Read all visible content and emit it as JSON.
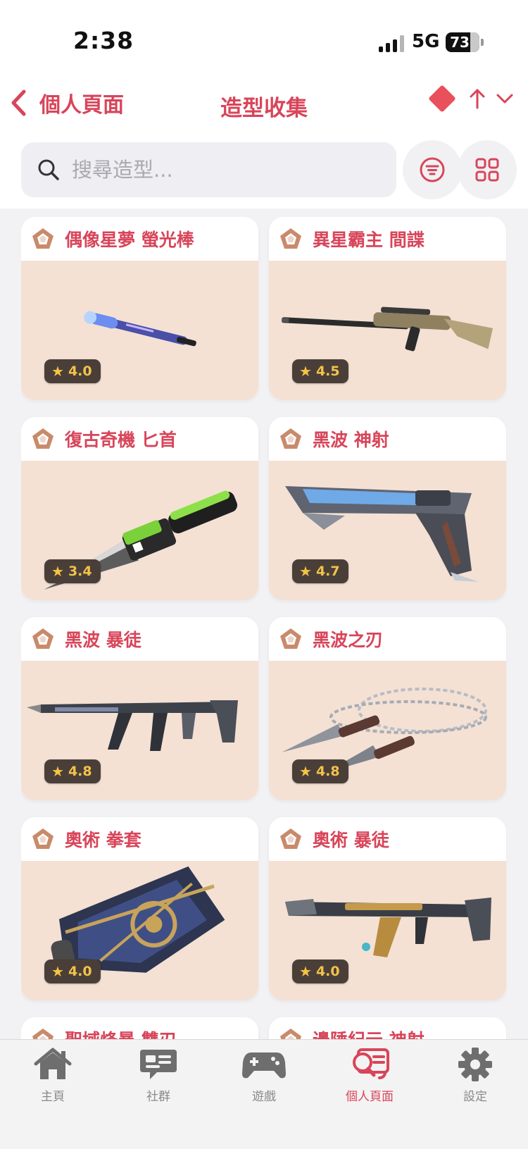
{
  "status_bar": {
    "time": "2:38",
    "network": "5G",
    "battery": "73"
  },
  "nav": {
    "back_label": "個人頁面",
    "title": "造型收集"
  },
  "search": {
    "placeholder": "搜尋造型..."
  },
  "colors": {
    "accent": "#d8455a",
    "card_bg": "#f4e1d4",
    "rating_bg": "#4a3f38",
    "star": "#f6c343"
  },
  "skins": [
    {
      "name": "偶像星夢 螢光棒",
      "rating": "4.0",
      "icon": "tier-pentagon-icon",
      "art": "bat"
    },
    {
      "name": "異星霸主 間諜",
      "rating": "4.5",
      "icon": "tier-pentagon-icon",
      "art": "sniper"
    },
    {
      "name": "復古奇機 匕首",
      "rating": "3.4",
      "icon": "tier-pentagon-icon",
      "art": "knife"
    },
    {
      "name": "黑波 神射",
      "rating": "4.7",
      "icon": "tier-pentagon-icon",
      "art": "pistol"
    },
    {
      "name": "黑波 暴徒",
      "rating": "4.8",
      "icon": "tier-pentagon-icon",
      "art": "rifle"
    },
    {
      "name": "黑波之刃",
      "rating": "4.8",
      "icon": "tier-pentagon-icon",
      "art": "kunai"
    },
    {
      "name": "奧術 拳套",
      "rating": "4.0",
      "icon": "tier-pentagon-icon",
      "art": "gauntlet"
    },
    {
      "name": "奧術 暴徒",
      "rating": "4.0",
      "icon": "tier-pentagon-icon",
      "art": "rifle2"
    },
    {
      "name": "聖域烽暴 雙刃",
      "rating": "",
      "icon": "tier-pentagon-icon",
      "art": "none"
    },
    {
      "name": "邊陲紀元 神射",
      "rating": "",
      "icon": "tier-pentagon-icon",
      "art": "none"
    }
  ],
  "tabs": [
    {
      "label": "主頁",
      "icon": "home-icon",
      "active": false
    },
    {
      "label": "社群",
      "icon": "chat-icon",
      "active": false
    },
    {
      "label": "遊戲",
      "icon": "gamepad-icon",
      "active": false
    },
    {
      "label": "個人頁面",
      "icon": "profile-search-icon",
      "active": true
    },
    {
      "label": "設定",
      "icon": "gear-icon",
      "active": false
    }
  ]
}
